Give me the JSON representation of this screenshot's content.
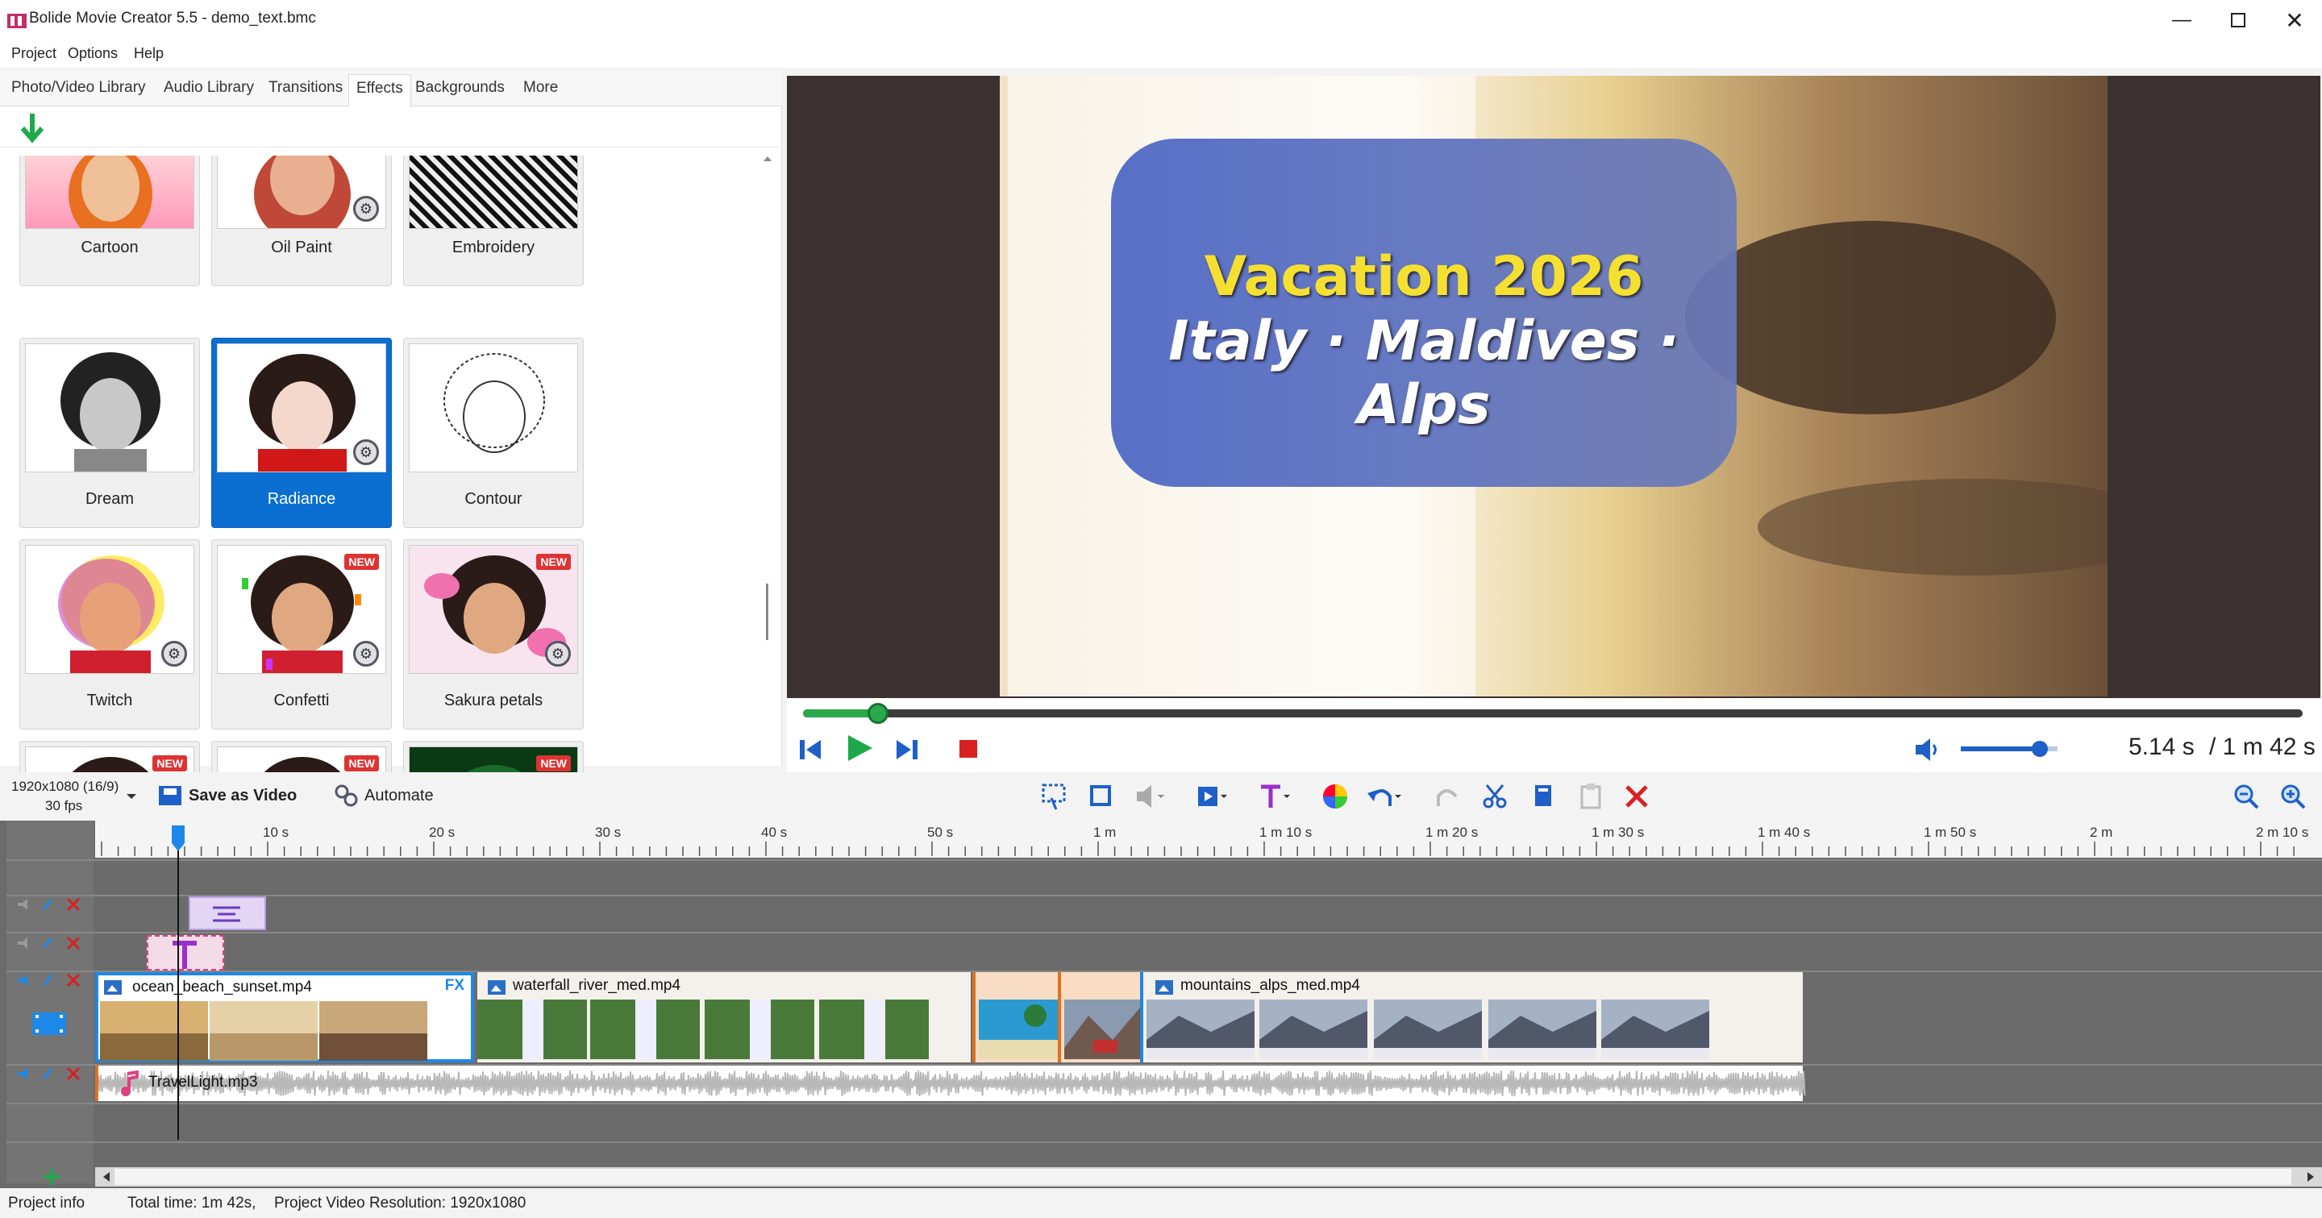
{
  "window": {
    "title": "Bolide Movie Creator 5.5 - demo_text.bmc"
  },
  "menu": [
    "Project",
    "Options",
    "Help"
  ],
  "tabs": [
    {
      "label": "Photo/Video Library",
      "active": false
    },
    {
      "label": "Audio Library",
      "active": false
    },
    {
      "label": "Transitions",
      "active": false
    },
    {
      "label": "Effects",
      "active": true
    },
    {
      "label": "Backgrounds",
      "active": false
    },
    {
      "label": "More",
      "active": false
    }
  ],
  "effects": [
    {
      "label": "Cartoon",
      "new": false,
      "settings": false,
      "selected": false
    },
    {
      "label": "Oil Paint",
      "new": false,
      "settings": true,
      "selected": false
    },
    {
      "label": "Embroidery",
      "new": false,
      "settings": false,
      "selected": false
    },
    {
      "label": "Dream",
      "new": false,
      "settings": false,
      "selected": false
    },
    {
      "label": "Radiance",
      "new": false,
      "settings": true,
      "selected": true
    },
    {
      "label": "Contour",
      "new": false,
      "settings": false,
      "selected": false
    },
    {
      "label": "Twitch",
      "new": false,
      "settings": true,
      "selected": false
    },
    {
      "label": "Confetti",
      "new": true,
      "settings": true,
      "selected": false
    },
    {
      "label": "Sakura petals",
      "new": true,
      "settings": true,
      "selected": false
    },
    {
      "label": "",
      "new": true,
      "settings": false,
      "selected": false
    },
    {
      "label": "",
      "new": true,
      "settings": false,
      "selected": false
    },
    {
      "label": "",
      "new": true,
      "settings": false,
      "selected": false
    }
  ],
  "badge_new": "NEW",
  "preview": {
    "title_line1": "Vacation 2026",
    "title_line2": "Italy · Maldives · Alps",
    "current_time": "5.14 s",
    "total_time": "/ 1 m 42 s",
    "playback_progress": 0.05,
    "volume_level": 0.82
  },
  "toolbar": {
    "resolution": "1920x1080 (16/9)",
    "fps": "30 fps",
    "save_label": "Save as Video",
    "automate_label": "Automate"
  },
  "ruler_ticks": [
    "10 s",
    "20 s",
    "30 s",
    "40 s",
    "50 s",
    "1 m",
    "1 m 10 s",
    "1 m 20 s",
    "1 m 30 s",
    "1 m 40 s",
    "1 m 50 s",
    "2 m",
    "2 m 10 s"
  ],
  "clips": {
    "video": [
      "ocean_beach_sunset.mp4",
      "waterfall_river_med.mp4",
      "mountains_alps_med.mp4"
    ],
    "fx_badge": "FX",
    "audio": "TravelLight.mp3"
  },
  "status": {
    "project_info": "Project info",
    "total_time": "Total time: 1m 42s,",
    "resolution": "Project Video Resolution:  1920x1080"
  },
  "colors": {
    "accent": "#0a6fd0",
    "delete_red": "#d82020",
    "title_yellow": "#f5e032",
    "text_box_blue": "#5a6fc0"
  }
}
